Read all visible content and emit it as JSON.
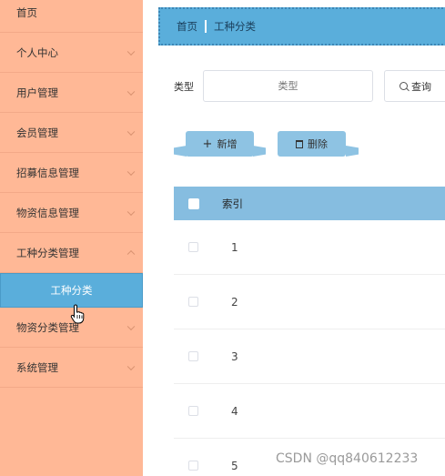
{
  "sidebar": {
    "items": [
      {
        "label": "首页"
      },
      {
        "label": "个人中心"
      },
      {
        "label": "用户管理"
      },
      {
        "label": "会员管理"
      },
      {
        "label": "招募信息管理"
      },
      {
        "label": "物资信息管理"
      },
      {
        "label": "工种分类管理"
      },
      {
        "label": "物资分类管理"
      },
      {
        "label": "系统管理"
      }
    ],
    "active_sub": "工种分类"
  },
  "breadcrumb": {
    "home": "首页",
    "current": "工种分类"
  },
  "search": {
    "label": "类型",
    "placeholder": "类型",
    "button": "查询"
  },
  "toolbar": {
    "add": "新增",
    "delete": "删除",
    "add_icon": "+"
  },
  "table": {
    "header": "索引",
    "rows": [
      "1",
      "2",
      "3",
      "4",
      "5"
    ]
  },
  "watermark": "CSDN @qq840612233",
  "colors": {
    "sidebar": "#ffb896",
    "accent": "#5aaedb",
    "header": "#86bde0",
    "button": "#8ec3e3"
  }
}
